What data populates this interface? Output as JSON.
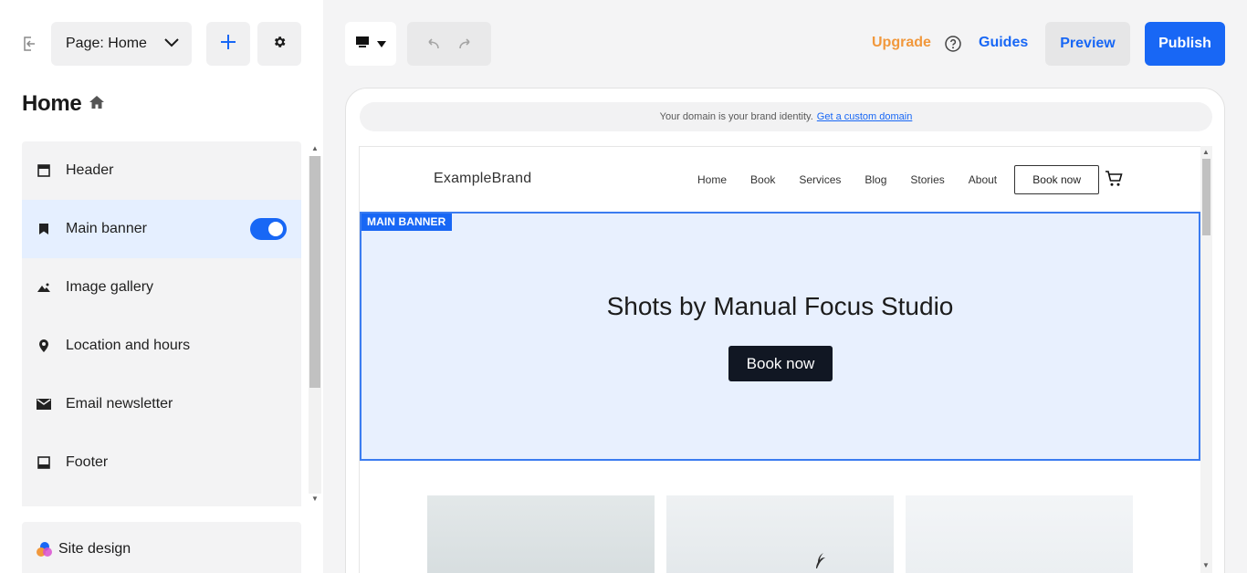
{
  "toolbar": {
    "page_select_label": "Page: Home",
    "upgrade_label": "Upgrade",
    "guides_label": "Guides",
    "preview_label": "Preview",
    "publish_label": "Publish"
  },
  "sidebar": {
    "page_title": "Home",
    "sections": [
      {
        "label": "Header",
        "icon": "header-icon"
      },
      {
        "label": "Main banner",
        "icon": "bookmark-icon",
        "active": true,
        "toggle_on": true
      },
      {
        "label": "Image gallery",
        "icon": "image-icon"
      },
      {
        "label": "Location and hours",
        "icon": "location-pin-icon"
      },
      {
        "label": "Email newsletter",
        "icon": "mail-icon"
      },
      {
        "label": "Footer",
        "icon": "footer-icon"
      }
    ],
    "site_design_label": "Site design"
  },
  "preview": {
    "domain_notice": "Your domain is your brand identity.",
    "domain_link": "Get a custom domain",
    "brand": "ExampleBrand",
    "nav_items": [
      "Home",
      "Book",
      "Services",
      "Blog",
      "Stories",
      "About"
    ],
    "nav_cta": "Book now",
    "banner_tag": "MAIN BANNER",
    "banner_title": "Shots by Manual Focus Studio",
    "banner_cta": "Book now"
  },
  "colors": {
    "accent": "#1867f5",
    "upgrade": "#f1983c",
    "banner_bg": "#e8f0fe",
    "banner_cta_bg": "#111723"
  }
}
